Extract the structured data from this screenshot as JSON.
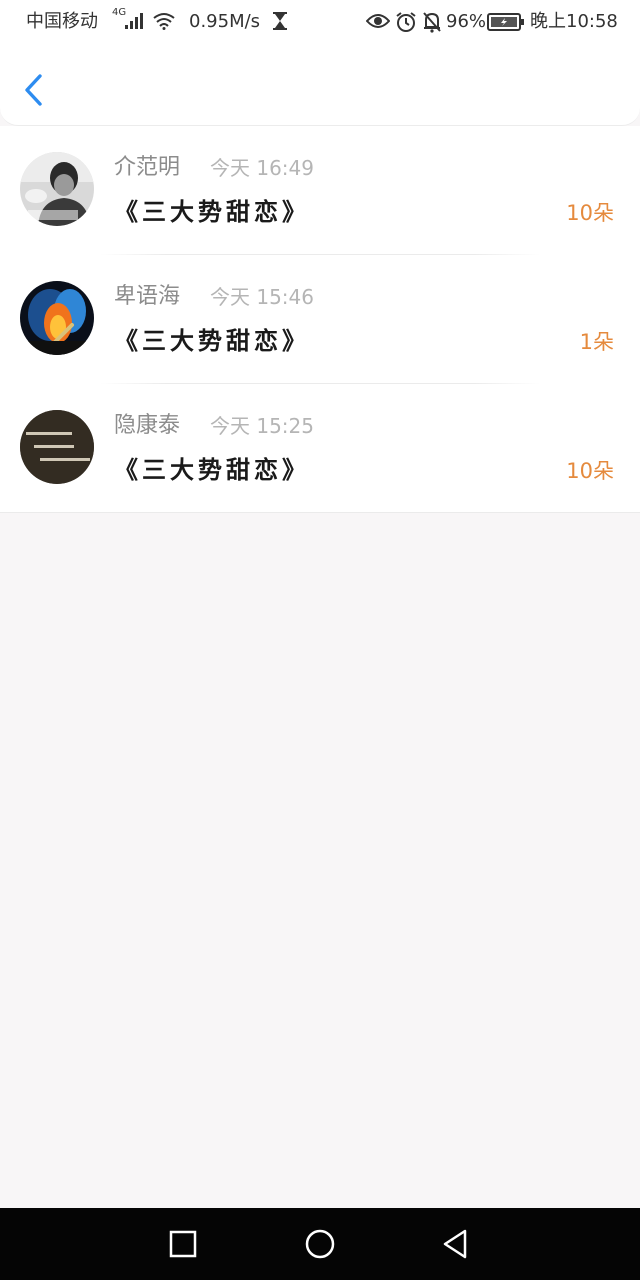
{
  "status_bar": {
    "carrier": "中国移动",
    "network": "4G",
    "speed": "0.95M/s",
    "battery": "96%",
    "time": "晚上10:58"
  },
  "header": {
    "back_icon": "chevron-left-icon"
  },
  "gifts": [
    {
      "name": "介范明",
      "time": "今天 16:49",
      "title": "《三大势甜恋》",
      "amount": "10朵",
      "avatar": "portrait-photo"
    },
    {
      "name": "卑语海",
      "time": "今天 15:46",
      "title": "《三大势甜恋》",
      "amount": "1朵",
      "avatar": "burning-match-photo"
    },
    {
      "name": "隐康泰",
      "time": "今天 15:25",
      "title": "《三大势甜恋》",
      "amount": "10朵",
      "avatar": "dark-text-photo"
    }
  ],
  "colors": {
    "accent_blue": "#2d8cf0",
    "gift_orange": "#e58a3d",
    "page_background": "#f8f6f7"
  },
  "nav_bar": {
    "recent_icon": "square-icon",
    "home_icon": "circle-icon",
    "back_icon": "triangle-back-icon"
  }
}
